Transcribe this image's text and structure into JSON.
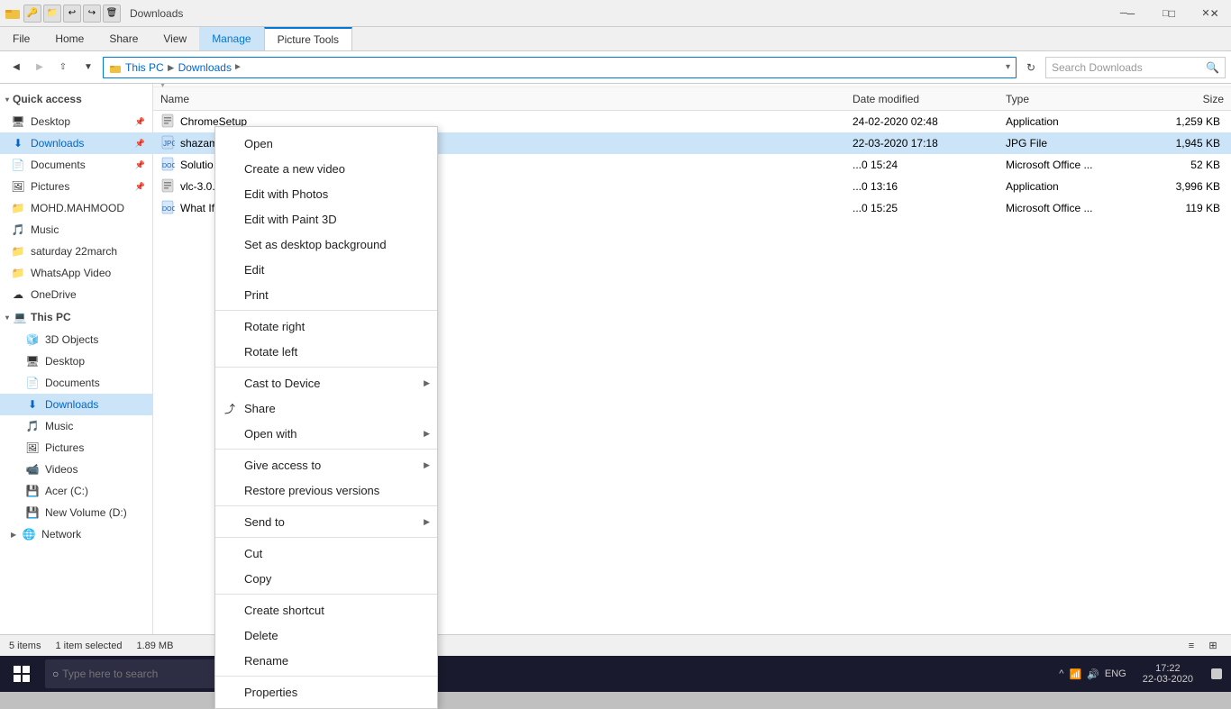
{
  "window": {
    "title": "Downloads",
    "titlebar": {
      "quickaccess_label": "Quick access toolbar"
    }
  },
  "ribbon": {
    "tabs": [
      {
        "label": "File",
        "active": false
      },
      {
        "label": "Home",
        "active": false
      },
      {
        "label": "Share",
        "active": false
      },
      {
        "label": "View",
        "active": false
      },
      {
        "label": "Picture Tools",
        "active": false
      },
      {
        "label": "Manage",
        "active": true
      }
    ]
  },
  "addressbar": {
    "back_tooltip": "Back",
    "forward_tooltip": "Forward",
    "up_tooltip": "Up",
    "path": [
      "This PC",
      "Downloads"
    ],
    "search_placeholder": "Search Downloads"
  },
  "sidebar": {
    "quick_access_label": "Quick access",
    "quick_access_arrow": "▾",
    "items_quick": [
      {
        "label": "Desktop",
        "pinned": true
      },
      {
        "label": "Downloads",
        "pinned": true,
        "active": true
      },
      {
        "label": "Documents",
        "pinned": true
      },
      {
        "label": "Pictures",
        "pinned": true
      }
    ],
    "special_items": [
      {
        "label": "MOHD.MAHMOOD"
      },
      {
        "label": "Music"
      },
      {
        "label": "saturday 22march"
      },
      {
        "label": "WhatsApp Video"
      }
    ],
    "onedrive_label": "OneDrive",
    "thispc_label": "This PC",
    "thispc_arrow": "▾",
    "items_thispc": [
      {
        "label": "3D Objects"
      },
      {
        "label": "Desktop"
      },
      {
        "label": "Documents"
      },
      {
        "label": "Downloads"
      },
      {
        "label": "Music"
      },
      {
        "label": "Pictures"
      },
      {
        "label": "Videos"
      },
      {
        "label": "Acer (C:)"
      },
      {
        "label": "New Volume (D:)"
      }
    ],
    "network_label": "Network"
  },
  "files": {
    "header": {
      "name": "Name",
      "date_modified": "Date modified",
      "type": "Type",
      "size": "Size"
    },
    "rows": [
      {
        "name": "ChromeSetup",
        "date": "24-02-2020 02:48",
        "type": "Application",
        "size": "1,259 KB",
        "icon": "app",
        "selected": false
      },
      {
        "name": "shazam",
        "date": "22-03-2020 17:18",
        "type": "JPG File",
        "size": "1,945 KB",
        "icon": "img",
        "selected": true
      },
      {
        "name": "Solutio...",
        "date": "...0 15:24",
        "type": "Microsoft Office ...",
        "size": "52 KB",
        "icon": "doc",
        "selected": false
      },
      {
        "name": "vlc-3.0...",
        "date": "...0 13:16",
        "type": "Application",
        "size": "3,996 KB",
        "icon": "app",
        "selected": false
      },
      {
        "name": "What If...",
        "date": "...0 15:25",
        "type": "Microsoft Office ...",
        "size": "119 KB",
        "icon": "doc",
        "selected": false
      }
    ]
  },
  "context_menu": {
    "items": [
      {
        "label": "Open",
        "icon": "",
        "has_sub": false,
        "separator_after": false
      },
      {
        "label": "Create a new video",
        "icon": "",
        "has_sub": false,
        "separator_after": false
      },
      {
        "label": "Edit with Photos",
        "icon": "",
        "has_sub": false,
        "separator_after": false
      },
      {
        "label": "Edit with Paint 3D",
        "icon": "",
        "has_sub": false,
        "separator_after": false
      },
      {
        "label": "Set as desktop background",
        "icon": "",
        "has_sub": false,
        "separator_after": false
      },
      {
        "label": "Edit",
        "icon": "",
        "has_sub": false,
        "separator_after": false
      },
      {
        "label": "Print",
        "icon": "",
        "has_sub": false,
        "separator_after": true
      },
      {
        "label": "Rotate right",
        "icon": "",
        "has_sub": false,
        "separator_after": false
      },
      {
        "label": "Rotate left",
        "icon": "",
        "has_sub": false,
        "separator_after": true
      },
      {
        "label": "Cast to Device",
        "icon": "",
        "has_sub": true,
        "separator_after": false
      },
      {
        "label": "Share",
        "icon": "share",
        "has_sub": false,
        "separator_after": false
      },
      {
        "label": "Open with",
        "icon": "",
        "has_sub": true,
        "separator_after": true
      },
      {
        "label": "Give access to",
        "icon": "",
        "has_sub": true,
        "separator_after": false
      },
      {
        "label": "Restore previous versions",
        "icon": "",
        "has_sub": false,
        "separator_after": true
      },
      {
        "label": "Send to",
        "icon": "",
        "has_sub": true,
        "separator_after": true
      },
      {
        "label": "Cut",
        "icon": "",
        "has_sub": false,
        "separator_after": false
      },
      {
        "label": "Copy",
        "icon": "",
        "has_sub": false,
        "separator_after": true
      },
      {
        "label": "Create shortcut",
        "icon": "",
        "has_sub": false,
        "separator_after": false
      },
      {
        "label": "Delete",
        "icon": "",
        "has_sub": false,
        "separator_after": false
      },
      {
        "label": "Rename",
        "icon": "",
        "has_sub": false,
        "separator_after": true
      },
      {
        "label": "Properties",
        "icon": "",
        "has_sub": false,
        "separator_after": false
      }
    ]
  },
  "statusbar": {
    "count": "5 items",
    "selected": "1 item selected",
    "size": "1.89 MB"
  },
  "taskbar": {
    "search_placeholder": "Type here to search",
    "time": "17:22",
    "date": "22-03-2020",
    "lang": "ENG"
  }
}
